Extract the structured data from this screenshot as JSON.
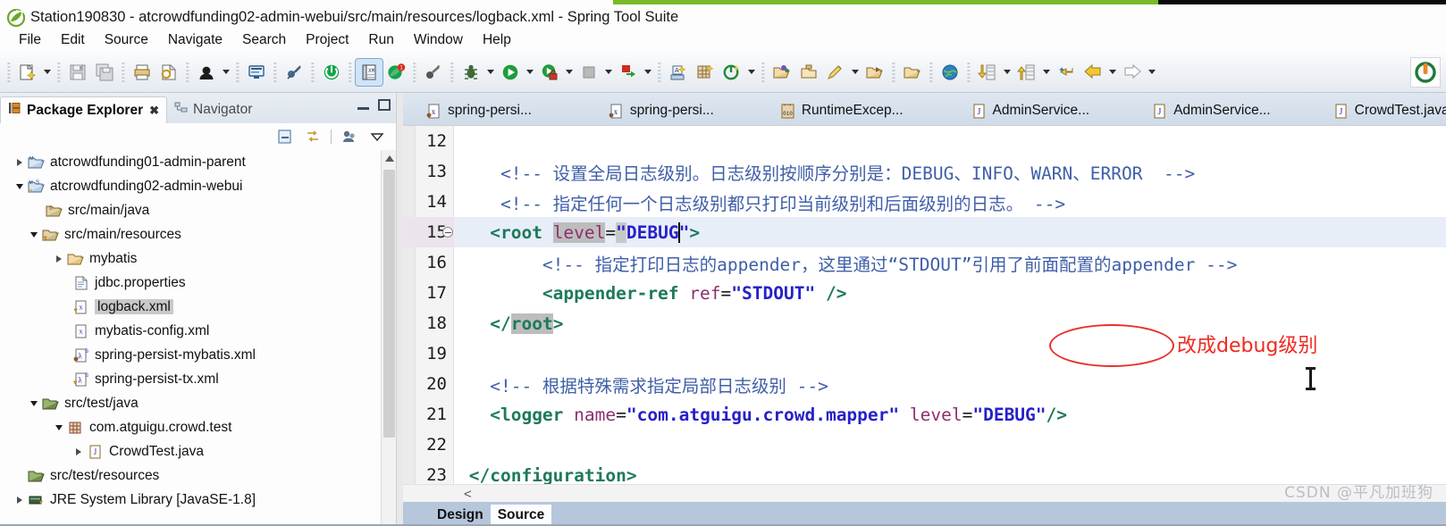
{
  "window": {
    "title": "Station190830 - atcrowdfunding02-admin-webui/src/main/resources/logback.xml - Spring Tool Suite",
    "logo_icon": "spring-leaf-icon"
  },
  "menubar": {
    "items": [
      "File",
      "Edit",
      "Source",
      "Navigate",
      "Search",
      "Project",
      "Run",
      "Window",
      "Help"
    ]
  },
  "toolbar": {
    "groups": [
      {
        "buttons": [
          {
            "icon": "new-file-icon",
            "dropdown": true
          }
        ]
      },
      {
        "buttons": [
          {
            "icon": "save-icon",
            "dropdown": false
          },
          {
            "icon": "save-all-icon",
            "dropdown": false
          }
        ]
      },
      {
        "buttons": [
          {
            "icon": "print-icon",
            "dropdown": false
          },
          {
            "icon": "refresh-resource-icon",
            "dropdown": false
          }
        ]
      },
      {
        "buttons": [
          {
            "icon": "boot-dashboard-icon",
            "dropdown": true
          }
        ]
      },
      {
        "buttons": [
          {
            "icon": "open-console-icon",
            "dropdown": false
          }
        ]
      },
      {
        "buttons": [
          {
            "icon": "skip-breakpoints-icon",
            "dropdown": false
          }
        ]
      },
      {
        "buttons": [
          {
            "icon": "spring-boot-icon",
            "dropdown": false
          }
        ]
      },
      {
        "buttons": [
          {
            "icon": "xml-editor-icon",
            "dropdown": false,
            "selected": true
          },
          {
            "icon": "spring-alert-icon",
            "dropdown": false,
            "badge": "1"
          }
        ]
      },
      {
        "buttons": [
          {
            "icon": "external-tools-icon",
            "dropdown": false
          }
        ]
      },
      {
        "buttons": [
          {
            "icon": "debug-icon",
            "dropdown": true
          },
          {
            "icon": "run-icon",
            "dropdown": true
          },
          {
            "icon": "run-lock-icon",
            "dropdown": true
          },
          {
            "icon": "stop-icon",
            "dropdown": true
          },
          {
            "icon": "run-last-icon",
            "dropdown": true
          }
        ]
      },
      {
        "buttons": [
          {
            "icon": "new-java-class-icon",
            "dropdown": false
          },
          {
            "icon": "new-package-icon",
            "dropdown": false
          },
          {
            "icon": "new-spring-bean-icon",
            "dropdown": true
          }
        ]
      },
      {
        "buttons": [
          {
            "icon": "open-type-icon",
            "dropdown": false
          },
          {
            "icon": "open-task-icon",
            "dropdown": false
          },
          {
            "icon": "search-marker-icon",
            "dropdown": true
          },
          {
            "icon": "open-resource-icon",
            "dropdown": false
          }
        ]
      },
      {
        "buttons": [
          {
            "icon": "open-web-browser-icon",
            "dropdown": false
          }
        ]
      },
      {
        "buttons": [
          {
            "icon": "globe-icon",
            "dropdown": false
          }
        ]
      },
      {
        "buttons": [
          {
            "icon": "next-annotation-icon",
            "dropdown": true
          },
          {
            "icon": "previous-annotation-icon",
            "dropdown": true
          },
          {
            "icon": "last-edit-location-icon",
            "dropdown": false
          },
          {
            "icon": "back-icon",
            "dropdown": true
          },
          {
            "icon": "forward-icon",
            "dropdown": true
          }
        ]
      }
    ],
    "right_icon": "ubuntu-icon"
  },
  "left_panel": {
    "tabs": [
      {
        "label": "Package Explorer",
        "icon": "package-explorer-icon",
        "active": true,
        "closeable": true
      },
      {
        "label": "Navigator",
        "icon": "navigator-icon",
        "active": false,
        "closeable": false
      }
    ],
    "window_buttons": [
      "minimize-view-button",
      "maximize-view-button"
    ],
    "view_toolbar_icons": [
      "collapse-all-icon",
      "link-with-editor-icon",
      "focus-on-active-task-icon",
      "view-menu-icon"
    ],
    "tree": [
      {
        "label": "atcrowdfunding01-admin-parent",
        "indent": 0,
        "twisty": "right",
        "icon": "maven-project-icon",
        "selected": false
      },
      {
        "label": "atcrowdfunding02-admin-webui",
        "indent": 0,
        "twisty": "down",
        "icon": "maven-spring-project-icon",
        "selected": false
      },
      {
        "label": "src/main/java",
        "indent": 1,
        "twisty": "none",
        "icon": "source-folder-icon",
        "selected": false
      },
      {
        "label": "src/main/resources",
        "indent": 1,
        "twisty": "down",
        "icon": "source-folder-warning-icon",
        "selected": false
      },
      {
        "label": "mybatis",
        "indent": 2,
        "twisty": "right",
        "icon": "folder-icon",
        "selected": false
      },
      {
        "label": "jdbc.properties",
        "indent": 2,
        "twisty": "none",
        "icon": "properties-file-icon",
        "selected": false
      },
      {
        "label": "logback.xml",
        "indent": 2,
        "twisty": "none",
        "icon": "xml-warning-file-icon",
        "selected": true
      },
      {
        "label": "mybatis-config.xml",
        "indent": 2,
        "twisty": "none",
        "icon": "xml-file-icon",
        "selected": false
      },
      {
        "label": "spring-persist-mybatis.xml",
        "indent": 2,
        "twisty": "none",
        "icon": "spring-xml-file-icon",
        "selected": false
      },
      {
        "label": "spring-persist-tx.xml",
        "indent": 2,
        "twisty": "none",
        "icon": "spring-xml-warning-file-icon",
        "selected": false
      },
      {
        "label": "src/test/java",
        "indent": 1,
        "twisty": "down",
        "icon": "source-folder-icon",
        "selected": false
      },
      {
        "label": "com.atguigu.crowd.test",
        "indent": 2,
        "twisty": "down",
        "icon": "package-icon",
        "selected": false
      },
      {
        "label": "CrowdTest.java",
        "indent": 3,
        "twisty": "right",
        "icon": "java-file-icon",
        "selected": false
      },
      {
        "label": "src/test/resources",
        "indent": 1,
        "twisty": "none",
        "icon": "source-folder-icon",
        "selected": false
      },
      {
        "label": "JRE System Library [JavaSE-1.8]",
        "indent": 1,
        "twisty": "right",
        "icon": "library-icon",
        "selected": false
      }
    ]
  },
  "editor": {
    "tabs": [
      {
        "label": "spring-persi...",
        "icon": "spring-xml-file-icon",
        "active": false
      },
      {
        "label": "spring-persi...",
        "icon": "spring-xml-file-icon",
        "active": false
      },
      {
        "label": "RuntimeExcep...",
        "icon": "class-file-icon",
        "active": false
      },
      {
        "label": "AdminService...",
        "icon": "java-file-icon",
        "active": false
      },
      {
        "label": "AdminService...",
        "icon": "java-file-icon",
        "active": false
      },
      {
        "label": "CrowdTest.java",
        "icon": "java-file-icon",
        "active": false
      }
    ],
    "bottom_tabs": [
      {
        "label": "Design",
        "active": false
      },
      {
        "label": "Source",
        "active": true
      }
    ],
    "horizontal_scroll_marker": "<",
    "lines": [
      {
        "num": "12",
        "highlighted": false,
        "folding": false,
        "segments": []
      },
      {
        "num": "13",
        "highlighted": false,
        "folding": false,
        "segments": [
          {
            "text": "    ",
            "style": "punct"
          },
          {
            "text": "<!-- 设置全局日志级别。日志级别按顺序分别是：DEBUG、INFO、WARN、ERROR  -->",
            "style": "cmt"
          }
        ]
      },
      {
        "num": "14",
        "highlighted": false,
        "folding": false,
        "segments": [
          {
            "text": "    ",
            "style": "punct"
          },
          {
            "text": "<!-- 指定任何一个日志级别都只打印当前级别和后面级别的日志。 -->",
            "style": "cmt"
          }
        ]
      },
      {
        "num": "15",
        "highlighted": true,
        "folding": true,
        "segments": [
          {
            "text": "   ",
            "style": "punct"
          },
          {
            "text": "<root",
            "style": "tag"
          },
          {
            "text": " ",
            "style": "punct"
          },
          {
            "text": "level",
            "style": "attr",
            "box": "hl"
          },
          {
            "text": "=",
            "style": "punct"
          },
          {
            "text": "\"",
            "style": "val",
            "box": "sel"
          },
          {
            "text": "DEBUG",
            "style": "val"
          },
          {
            "text": "|",
            "style": "caret"
          },
          {
            "text": "\"",
            "style": "val"
          },
          {
            "text": ">",
            "style": "tag"
          }
        ]
      },
      {
        "num": "16",
        "highlighted": false,
        "folding": false,
        "segments": [
          {
            "text": "        ",
            "style": "punct"
          },
          {
            "text": "<!-- 指定打印日志的appender，这里通过“STDOUT”引用了前面配置的appender -->",
            "style": "cmt"
          }
        ]
      },
      {
        "num": "17",
        "highlighted": false,
        "folding": false,
        "segments": [
          {
            "text": "        ",
            "style": "punct"
          },
          {
            "text": "<appender-ref",
            "style": "tag"
          },
          {
            "text": " ",
            "style": "punct"
          },
          {
            "text": "ref",
            "style": "attr"
          },
          {
            "text": "=",
            "style": "punct"
          },
          {
            "text": "\"STDOUT\"",
            "style": "val"
          },
          {
            "text": " ",
            "style": "punct"
          },
          {
            "text": "/>",
            "style": "tag"
          }
        ]
      },
      {
        "num": "18",
        "highlighted": false,
        "folding": false,
        "segments": [
          {
            "text": "   ",
            "style": "punct"
          },
          {
            "text": "</",
            "style": "tag"
          },
          {
            "text": "root",
            "style": "tag",
            "box": "hl"
          },
          {
            "text": ">",
            "style": "tag"
          }
        ]
      },
      {
        "num": "19",
        "highlighted": false,
        "folding": false,
        "segments": []
      },
      {
        "num": "20",
        "highlighted": false,
        "folding": false,
        "segments": [
          {
            "text": "   ",
            "style": "punct"
          },
          {
            "text": "<!-- 根据特殊需求指定局部日志级别 -->",
            "style": "cmt"
          }
        ]
      },
      {
        "num": "21",
        "highlighted": false,
        "folding": false,
        "segments": [
          {
            "text": "   ",
            "style": "punct"
          },
          {
            "text": "<logger",
            "style": "tag"
          },
          {
            "text": " ",
            "style": "punct"
          },
          {
            "text": "name",
            "style": "attr"
          },
          {
            "text": "=",
            "style": "punct"
          },
          {
            "text": "\"com.atguigu.crowd.mapper\"",
            "style": "val"
          },
          {
            "text": " ",
            "style": "punct"
          },
          {
            "text": "level",
            "style": "attr"
          },
          {
            "text": "=",
            "style": "punct"
          },
          {
            "text": "\"DEBUG\"",
            "style": "val"
          },
          {
            "text": "/>",
            "style": "tag"
          }
        ]
      },
      {
        "num": "22",
        "highlighted": false,
        "folding": false,
        "segments": []
      },
      {
        "num": "23",
        "highlighted": false,
        "folding": false,
        "segments": [
          {
            "text": " ",
            "style": "punct"
          },
          {
            "text": "</configuration>",
            "style": "tag"
          }
        ]
      }
    ]
  },
  "annotation": {
    "text": "改成debug级别",
    "color": "#ee2a22",
    "shape": "ellipse-around-debug-value"
  },
  "watermark": {
    "text": "CSDN @平凡加班狗"
  },
  "colors": {
    "accent_green": "#7ab929",
    "annotation_red": "#ee2a22",
    "tag_green": "#1d7a5a",
    "attr_magenta": "#8c2f6d",
    "value_blue": "#2621c9",
    "comment_blue": "#3f5fa8",
    "current_line": "#e7eef8",
    "editor_tabbar": "#cfdbe9"
  }
}
